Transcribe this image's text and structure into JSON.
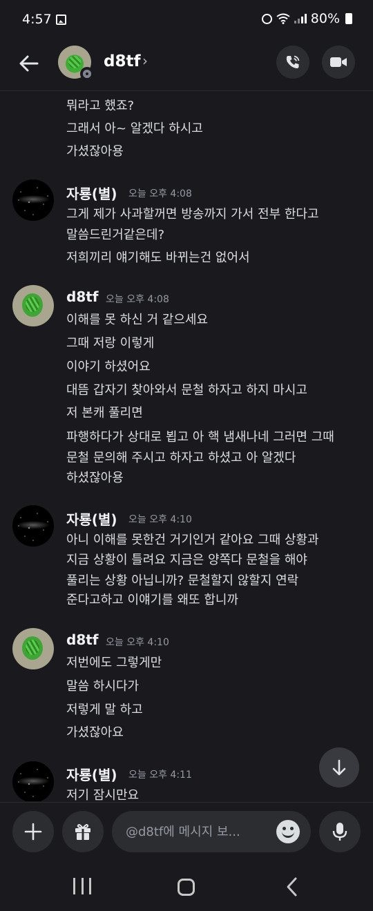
{
  "status_bar": {
    "time": "4:57",
    "battery": "80%"
  },
  "header": {
    "name": "d8tf",
    "chevron": "›"
  },
  "top_lines": [
    "뭐라고 했죠?",
    "그래서 아~ 알겠다 하시고",
    "가셨잖아용"
  ],
  "groups": [
    {
      "author": "자룡(별)",
      "time": "오늘 오후 4:08",
      "avatar": "stars",
      "lines": [
        "그게 제가 사과할꺼면 방송까지 가서 전부 한다고",
        "말씀드린거같은데?",
        "저희끼리 얘기해도 바뀌는건 없어서"
      ]
    },
    {
      "author": "d8tf",
      "time": "오늘 오후 4:08",
      "avatar": "turtle",
      "lines": [
        "이해를 못 하신 거 같으세요",
        "그때 저랑 이렇게",
        "이야기 하셨어요",
        "대뜸 갑자기 찾아와서 문철 하자고 하지 마시고",
        "저 본캐 풀리면",
        "파행하다가 상대로 뵙고 아 핵 냄새나네 그러면 그때",
        "문철 문의해 주시고 하자고 하셨고 아 알겠다",
        "하셨잖아용"
      ]
    },
    {
      "author": "자룡(별)",
      "time": "오늘 오후 4:10",
      "avatar": "stars",
      "lines": [
        "아니 이해를 못한건 거기인거 같아요 그때 상황과",
        "지금 상황이 틀려요 지금은 양쪽다 문철을 해야",
        "풀리는 상황 아닙니까? 문철할지 않할지 연락",
        "준다고하고 이얘기를 왜또 합니까"
      ]
    },
    {
      "author": "d8tf",
      "time": "오늘 오후 4:10",
      "avatar": "turtle",
      "lines": [
        "저번에도 그렇게만",
        "말씀 하시다가",
        "저렇게 말 하고",
        "가셨잖아요"
      ]
    },
    {
      "author": "자룡(별)",
      "time": "오늘 오후 4:11",
      "avatar": "stars",
      "lines": [
        "저기 잠시만요"
      ]
    }
  ],
  "composer": {
    "placeholder": "@d8tf에 메시지 보..."
  },
  "icons": {
    "back": "arrow-left-icon",
    "call": "phone-icon",
    "video": "video-camera-icon",
    "plus": "plus-icon",
    "gift": "gift-icon",
    "emoji": "emoji-icon",
    "mic": "microphone-icon",
    "scroll": "arrow-down-icon"
  },
  "colors": {
    "background": "#1a1a1e",
    "surface": "#2b2d31",
    "text": "#dbdee1",
    "muted": "#949ba4"
  }
}
